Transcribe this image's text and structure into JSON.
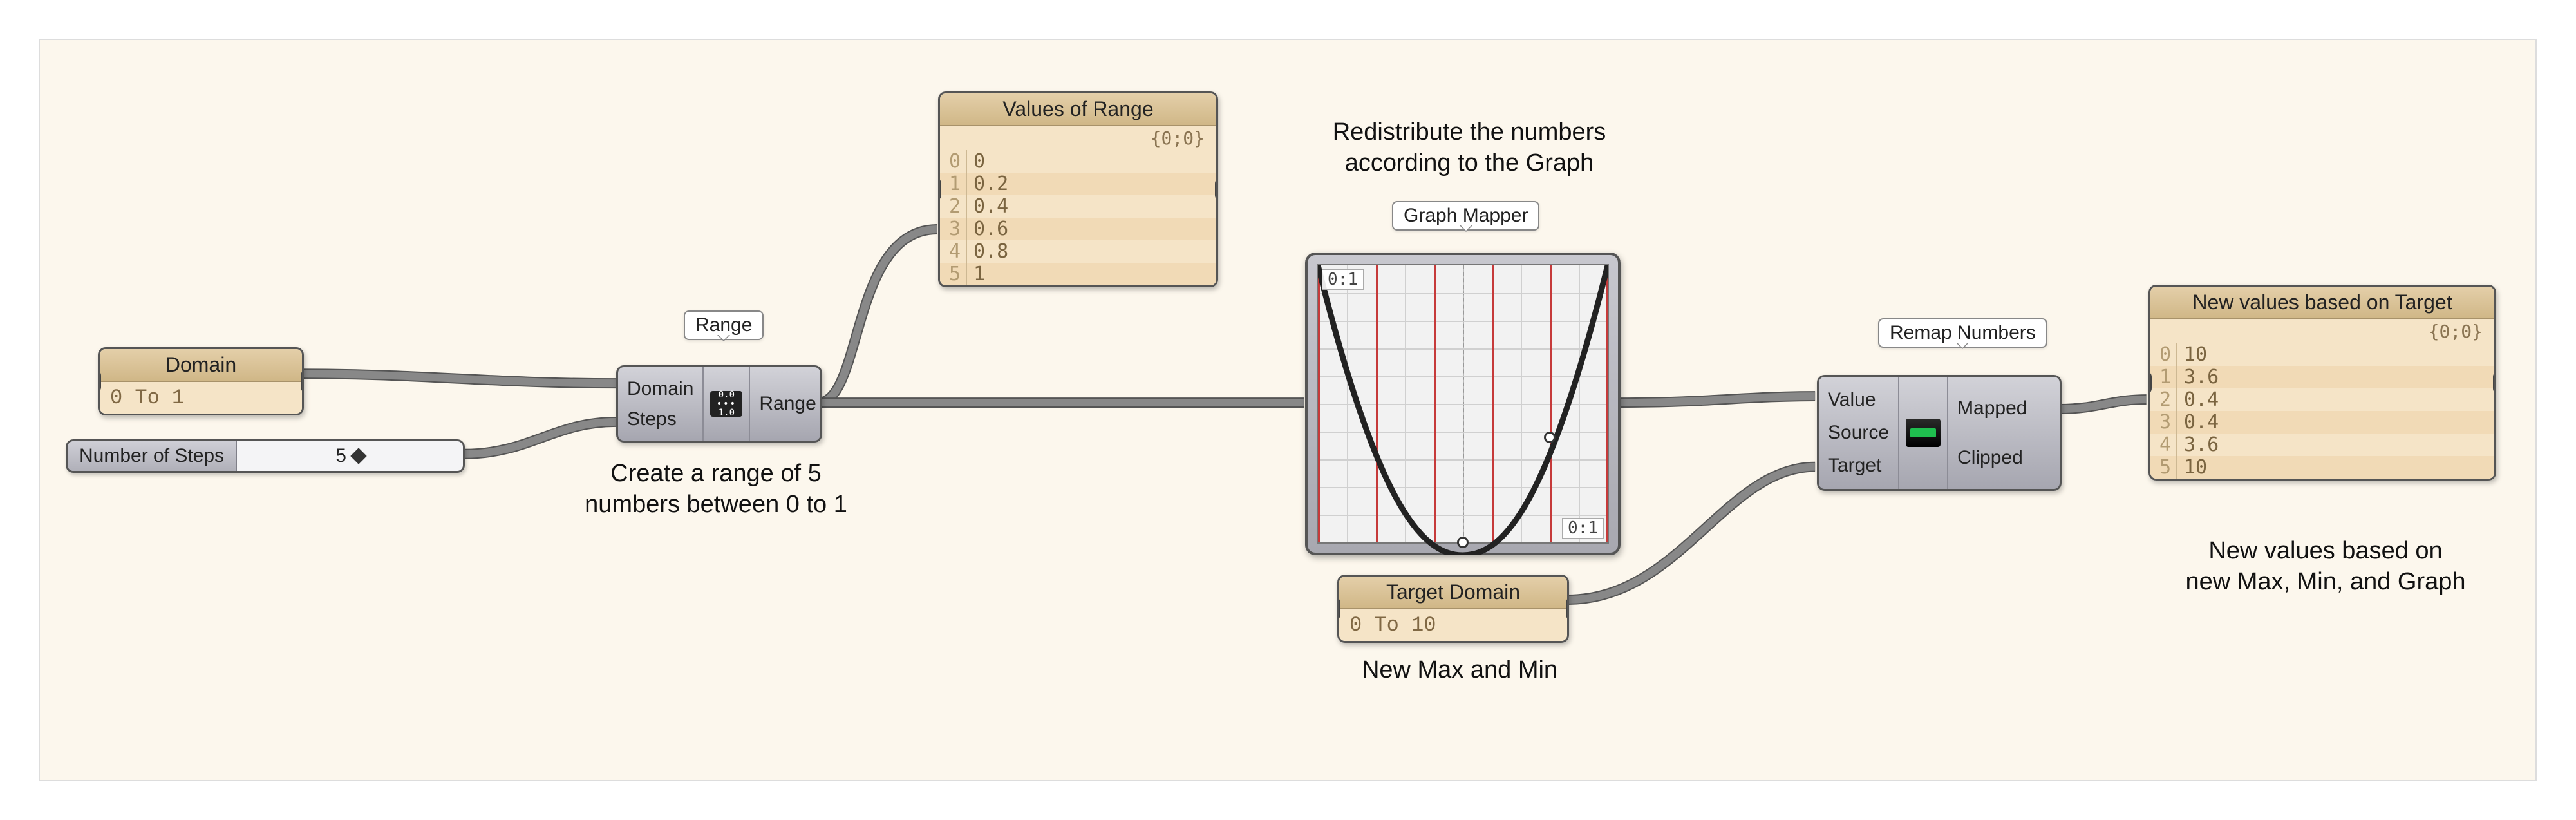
{
  "labels": {
    "range": "Range",
    "graph_mapper": "Graph Mapper",
    "remap": "Remap Numbers"
  },
  "domain_panel": {
    "title": "Domain",
    "value": "0 To 1"
  },
  "steps_slider": {
    "label": "Number of Steps",
    "value": "5"
  },
  "range_component": {
    "inputs": [
      "Domain",
      "Steps"
    ],
    "outputs": [
      "Range"
    ],
    "icon_top": "0.0",
    "icon_bottom": "1.0"
  },
  "values_panel": {
    "title": "Values of Range",
    "path": "{0;0}",
    "rows": [
      {
        "idx": "0",
        "val": "0"
      },
      {
        "idx": "1",
        "val": "0.2"
      },
      {
        "idx": "2",
        "val": "0.4"
      },
      {
        "idx": "3",
        "val": "0.6"
      },
      {
        "idx": "4",
        "val": "0.8"
      },
      {
        "idx": "5",
        "val": "1"
      }
    ]
  },
  "graph": {
    "x_tag": "0:1",
    "y_tag": "0:1"
  },
  "remap_component": {
    "inputs": [
      "Value",
      "Source",
      "Target"
    ],
    "outputs": [
      "Mapped",
      "Clipped"
    ]
  },
  "target_panel": {
    "title": "Target Domain",
    "value": "0 To 10"
  },
  "output_panel": {
    "title": "New values based on Target",
    "path": "{0;0}",
    "rows": [
      {
        "idx": "0",
        "val": "10"
      },
      {
        "idx": "1",
        "val": "3.6"
      },
      {
        "idx": "2",
        "val": "0.4"
      },
      {
        "idx": "3",
        "val": "0.4"
      },
      {
        "idx": "4",
        "val": "3.6"
      },
      {
        "idx": "5",
        "val": "10"
      }
    ]
  },
  "annotations": {
    "range_desc": "Create a range of 5\nnumbers between 0 to 1",
    "graph_desc": "Redistribute the numbers\naccording to the Graph",
    "target_desc": "New Max and Min",
    "output_desc": "New values based on\nnew Max, Min, and Graph"
  }
}
